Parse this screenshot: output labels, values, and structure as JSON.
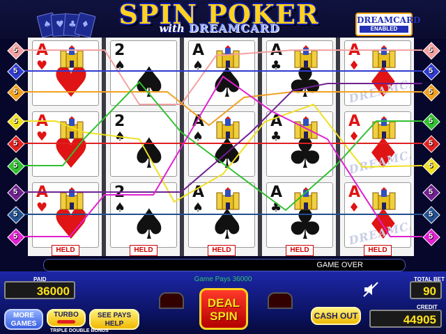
{
  "header": {
    "title": "SPIN POKER",
    "subtitle_with": "with",
    "subtitle_brand": "DREAMCARD",
    "badge_title": "DREAMCARD",
    "badge_sub": "ENABLED"
  },
  "columns": [
    {
      "cards": [
        {
          "rank": "A",
          "suit": "♥",
          "color": "red",
          "castle": true
        },
        {
          "rank": "A",
          "suit": "♥",
          "color": "red",
          "castle": true
        },
        {
          "rank": "A",
          "suit": "♥",
          "color": "red",
          "castle": true
        }
      ],
      "held_label": "HELD"
    },
    {
      "cards": [
        {
          "rank": "2",
          "suit": "♠",
          "color": "blk",
          "castle": false
        },
        {
          "rank": "2",
          "suit": "♠",
          "color": "blk",
          "castle": false
        },
        {
          "rank": "2",
          "suit": "♠",
          "color": "blk",
          "castle": false
        }
      ],
      "held_label": "HELD"
    },
    {
      "cards": [
        {
          "rank": "A",
          "suit": "♠",
          "color": "blk",
          "castle": true
        },
        {
          "rank": "A",
          "suit": "♠",
          "color": "blk",
          "castle": true
        },
        {
          "rank": "A",
          "suit": "♠",
          "color": "blk",
          "castle": true
        }
      ],
      "held_label": "HELD"
    },
    {
      "cards": [
        {
          "rank": "A",
          "suit": "♣",
          "color": "blk",
          "castle": true
        },
        {
          "rank": "A",
          "suit": "♣",
          "color": "blk",
          "castle": true
        },
        {
          "rank": "A",
          "suit": "♣",
          "color": "blk",
          "castle": true
        }
      ],
      "held_label": "HELD"
    },
    {
      "cards": [
        {
          "rank": "A",
          "suit": "♦",
          "color": "red",
          "castle": true,
          "dreamcard": true
        },
        {
          "rank": "A",
          "suit": "♦",
          "color": "red",
          "castle": true,
          "dreamcard": true
        },
        {
          "rank": "A",
          "suit": "♦",
          "color": "red",
          "castle": true,
          "dreamcard": true
        }
      ],
      "held_label": "HELD"
    }
  ],
  "dreamcard_watermark": "DREAMCARD",
  "paylines": {
    "left": [
      {
        "num": "5",
        "color": "#f4a0a0"
      },
      {
        "num": "5",
        "color": "#2f3ad0"
      },
      {
        "num": "5",
        "color": "#f0a020"
      },
      {
        "num": "5",
        "color": "#f0e020"
      },
      {
        "num": "5",
        "color": "#e02020"
      },
      {
        "num": "5",
        "color": "#30c030"
      },
      {
        "num": "5",
        "color": "#702090"
      },
      {
        "num": "5",
        "color": "#205090"
      },
      {
        "num": "5",
        "color": "#e020d0"
      }
    ],
    "right": [
      {
        "num": "5",
        "color": "#f4a0a0"
      },
      {
        "num": "5",
        "color": "#2f3ad0"
      },
      {
        "num": "5",
        "color": "#f0a020"
      },
      {
        "num": "5",
        "color": "#30c030"
      },
      {
        "num": "5",
        "color": "#e02020"
      },
      {
        "num": "5",
        "color": "#f0e020"
      },
      {
        "num": "5",
        "color": "#702090"
      },
      {
        "num": "5",
        "color": "#205090"
      },
      {
        "num": "5",
        "color": "#e020d0"
      }
    ]
  },
  "status": {
    "message": "GAME OVER",
    "game_pays": "Game Pays 36000"
  },
  "console": {
    "paid_label": "PAID",
    "paid_value": "36000",
    "total_bet_label": "TOTAL BET",
    "total_bet_value": "90",
    "credit_label": "CREDIT",
    "credit_value": "44905",
    "more_games": "MORE GAMES",
    "turbo": "TURBO",
    "see_pays": "SEE PAYS HELP",
    "deal": "DEAL",
    "spin": "SPIN",
    "cash_out": "CASH OUT",
    "game_name": "TRIPLE DOUBLE BONUS",
    "speaker_icon": "speaker-muted-icon"
  }
}
